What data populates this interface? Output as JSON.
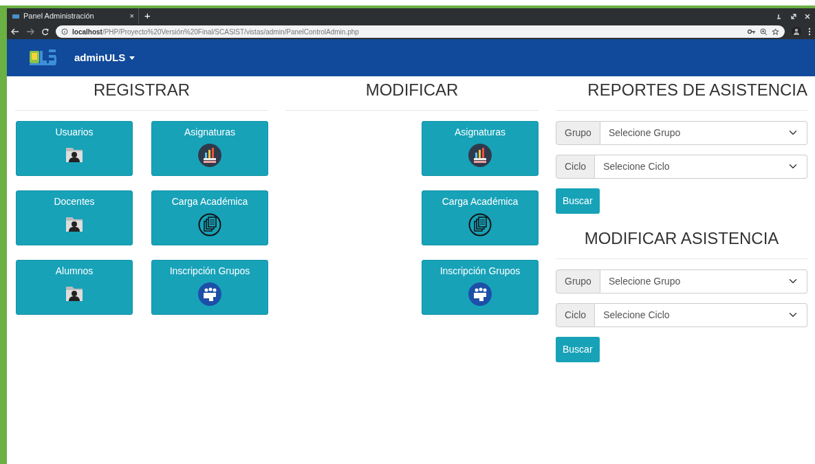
{
  "browser": {
    "tab": {
      "title": "Panel Administración",
      "close": "×"
    },
    "new_tab": "+",
    "url": {
      "host": "localhost",
      "path": "/PHP/Proyecto%20Versión%20Final/SCASIST/vistas/admin/PanelControlAdmin.php"
    }
  },
  "navbar": {
    "user": "adminULS"
  },
  "registrar": {
    "title": "REGISTRAR",
    "tiles": [
      {
        "label": "Usuarios",
        "kind": "folder"
      },
      {
        "label": "Asignaturas",
        "kind": "chart"
      },
      {
        "label": "Docentes",
        "kind": "folder"
      },
      {
        "label": "Carga Académica",
        "kind": "documents"
      },
      {
        "label": "Alumnos",
        "kind": "folder"
      },
      {
        "label": "Inscripción Grupos",
        "kind": "people"
      }
    ]
  },
  "modificar": {
    "title": "MODIFICAR",
    "tiles": [
      {
        "label": "Asignaturas",
        "kind": "chart"
      },
      {
        "label": "Carga Académica",
        "kind": "documents"
      },
      {
        "label": "Inscripción Grupos",
        "kind": "people"
      }
    ]
  },
  "forms": [
    {
      "title": "REPORTES DE ASISTENCIA",
      "fields": [
        {
          "label": "Grupo",
          "placeholder": "Selecione Grupo"
        },
        {
          "label": "Ciclo",
          "placeholder": "Selecione Ciclo"
        }
      ],
      "button": "Buscar"
    },
    {
      "title": "MODIFICAR ASISTENCIA",
      "fields": [
        {
          "label": "Grupo",
          "placeholder": "Selecione Grupo"
        },
        {
          "label": "Ciclo",
          "placeholder": "Selecione Ciclo"
        }
      ],
      "button": "Buscar"
    }
  ]
}
